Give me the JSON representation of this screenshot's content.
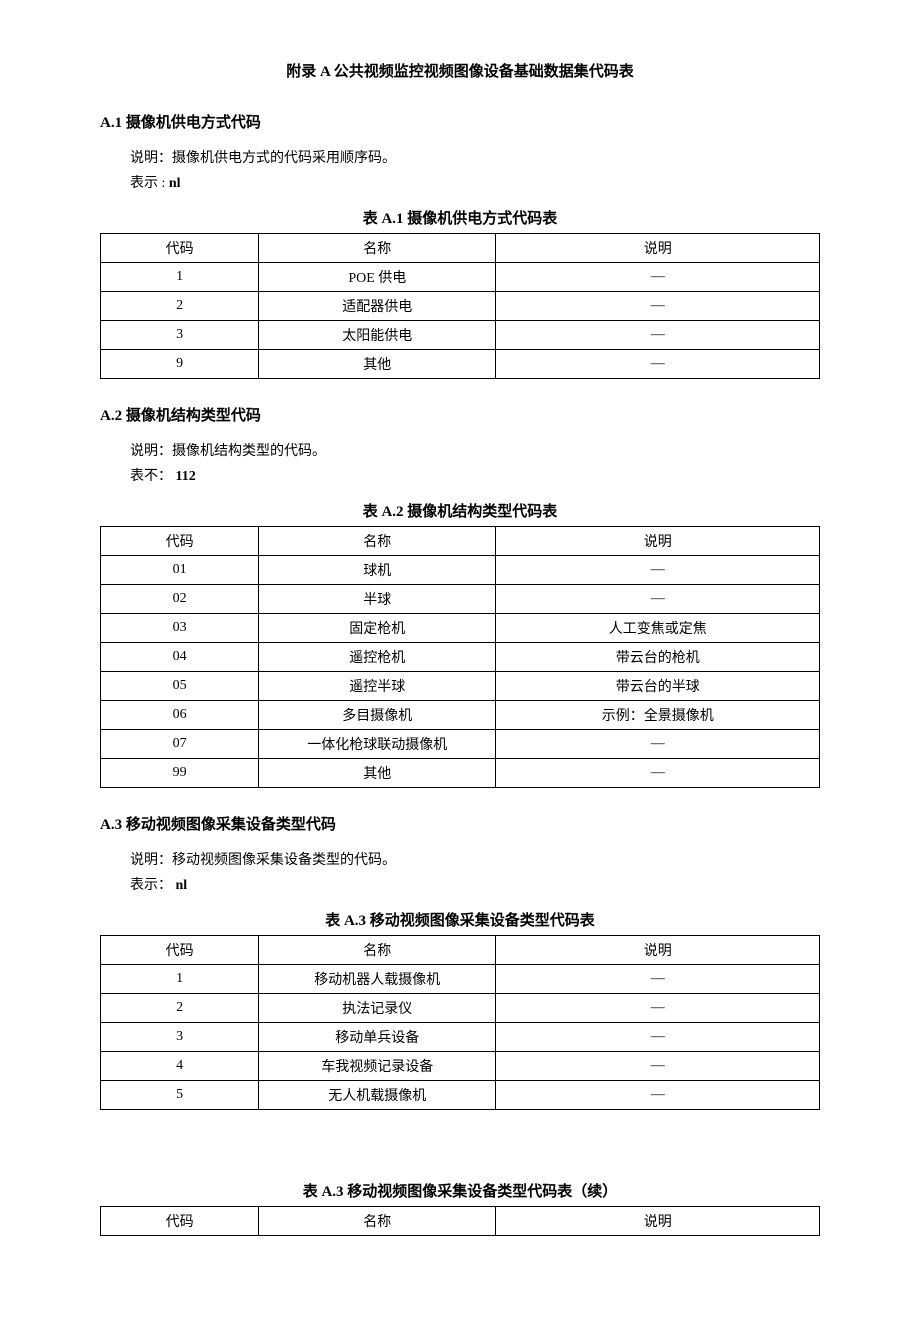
{
  "page_title_prefix": "附录 ",
  "page_title_bold": "A ",
  "page_title_rest": "公共视频监控视频图像设备基础数据集代码表",
  "sections": {
    "a1": {
      "heading": "A.1 摄像机供电方式代码",
      "desc": "说明：摄像机供电方式的代码采用顺序码。",
      "repr_label": "表示 :",
      "repr_val": " nl",
      "caption_prefix": "表 ",
      "caption_bold": "A.1 ",
      "caption_rest": "摄像机供电方式代码表",
      "headers": [
        "代码",
        "名称",
        "说明"
      ],
      "rows": [
        [
          "1",
          "POE 供电",
          "—"
        ],
        [
          "2",
          "适配器供电",
          "—"
        ],
        [
          "3",
          "太阳能供电",
          "—"
        ],
        [
          "9",
          "其他",
          "—"
        ]
      ]
    },
    "a2": {
      "heading": "A.2 摄像机结构类型代码",
      "desc": "说明：摄像机结构类型的代码。",
      "repr_label": "表不：",
      "repr_val": " 112",
      "caption_prefix": "表 ",
      "caption_bold": "A.2 ",
      "caption_rest": "摄像机结构类型代码表",
      "headers": [
        "代码",
        "名称",
        "说明"
      ],
      "rows": [
        [
          "01",
          "球机",
          "—"
        ],
        [
          "02",
          "半球",
          "—"
        ],
        [
          "03",
          "固定枪机",
          "人工变焦或定焦"
        ],
        [
          "04",
          "遥控枪机",
          "带云台的枪机"
        ],
        [
          "05",
          "遥控半球",
          "带云台的半球"
        ],
        [
          "06",
          "多目摄像机",
          "示例：全景摄像机"
        ],
        [
          "07",
          "一体化枪球联动摄像机",
          "—"
        ],
        [
          "99",
          "其他",
          "—"
        ]
      ]
    },
    "a3": {
      "heading": "A.3 移动视频图像采集设备类型代码",
      "desc": "说明：移动视频图像采集设备类型的代码。",
      "repr_label": "表示：",
      "repr_val": " nl",
      "caption_prefix": "表 ",
      "caption_bold": "A.3 ",
      "caption_rest": "移动视频图像采集设备类型代码表",
      "headers": [
        "代码",
        "名称",
        "说明"
      ],
      "rows": [
        [
          "1",
          "移动机器人载摄像机",
          "—"
        ],
        [
          "2",
          "执法记录仪",
          "—"
        ],
        [
          "3",
          "移动单兵设备",
          "—"
        ],
        [
          "4",
          "车我视频记录设备",
          "—"
        ],
        [
          "5",
          "无人机载摄像机",
          "—"
        ]
      ]
    },
    "a3cont": {
      "caption_prefix": "表 ",
      "caption_bold": "A.3 ",
      "caption_rest": "移动视频图像采集设备类型代码表（续）",
      "headers": [
        "代码",
        "名称",
        "说明"
      ]
    }
  }
}
